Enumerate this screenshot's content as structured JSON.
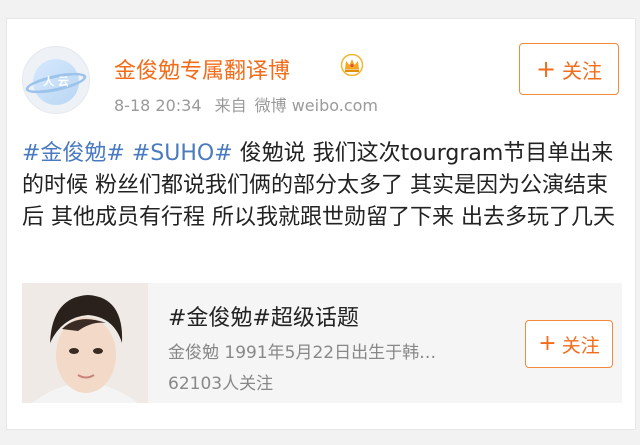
{
  "post": {
    "author": {
      "name": "金俊勉专属翻译博",
      "avatar_text": "人 云",
      "badge_icon": "crown-icon"
    },
    "meta": {
      "time": "8-18 20:34",
      "source_prefix": "来自",
      "source": "微博 weibo.com"
    },
    "follow_button": {
      "icon": "plus-icon",
      "label": "关注"
    },
    "text": {
      "topic1": "#金俊勉#",
      "topic2": "#SUHO#",
      "body": "俊勉说 我们这次tourgram节目单出来的时候 粉丝们都说我们俩的部分太多了 其实是因为公演结束后 其他成员有行程 所以我就跟世勋留了下来 出去多玩了几天"
    }
  },
  "topic_card": {
    "title": "#金俊勉#超级话题",
    "description": "金俊勉 1991年5月22日出生于韩…",
    "followers": "62103人关注",
    "follow_button": {
      "icon": "plus-icon",
      "label": "关注"
    }
  },
  "colors": {
    "accent": "#f26c1a",
    "link": "#4a7bc0",
    "meta": "#9a9a9a"
  }
}
